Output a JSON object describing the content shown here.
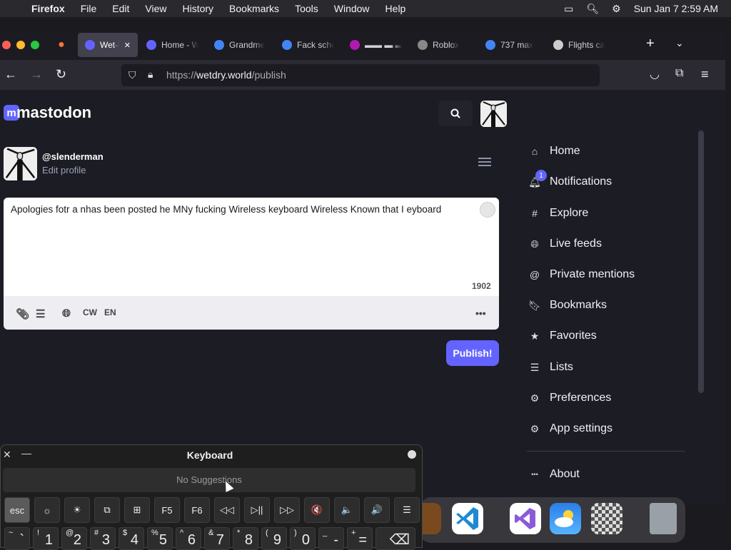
{
  "menubar": {
    "app": "Firefox",
    "items": [
      "File",
      "Edit",
      "View",
      "History",
      "Bookmarks",
      "Tools",
      "Window",
      "Help"
    ],
    "datetime": "Sun Jan 7  2:59 AM"
  },
  "tabs": [
    {
      "label": "Wet-Dr",
      "icon": "mastodon-icon",
      "color": "#6364ff",
      "active": true
    },
    {
      "label": "Home - W",
      "icon": "mastodon-icon",
      "color": "#6364ff"
    },
    {
      "label": "Grandme",
      "icon": "google-icon",
      "color": "#4285f4"
    },
    {
      "label": "Fack sche",
      "icon": "google-icon",
      "color": "#4285f4"
    },
    {
      "label": "▬▬ ▬ ▬",
      "icon": "purple-square-icon",
      "color": "#b01ab0"
    },
    {
      "label": "Roblox",
      "icon": "roblox-icon",
      "color": "#888888"
    },
    {
      "label": "737 max",
      "icon": "google-icon",
      "color": "#4285f4"
    },
    {
      "label": "Flights ca",
      "icon": "flights-icon",
      "color": "#cccccc"
    }
  ],
  "url": {
    "prefix": "https://",
    "domain": "wetdry.world",
    "path": "/publish"
  },
  "profile": {
    "handle": "@slenderman",
    "edit": "Edit profile"
  },
  "brand": "mastodon",
  "composer": {
    "text": "Apologies fotr a nhas been posted he MNy fucking  Wireless keyboard Wireless Known that I eyboard",
    "char_count": "1902",
    "cw": "CW",
    "lang": "EN"
  },
  "publish_label": "Publish!",
  "nav": [
    {
      "label": "Home",
      "icon": "home-icon"
    },
    {
      "label": "Notifications",
      "icon": "bell-icon",
      "badge": "1"
    },
    {
      "label": "Explore",
      "icon": "hashtag-icon"
    },
    {
      "label": "Live feeds",
      "icon": "globe-icon"
    },
    {
      "label": "Private mentions",
      "icon": "at-icon"
    },
    {
      "label": "Bookmarks",
      "icon": "bookmark-icon"
    },
    {
      "label": "Favorites",
      "icon": "star-icon"
    },
    {
      "label": "Lists",
      "icon": "list-icon"
    },
    {
      "label": "Preferences",
      "icon": "gear-icon"
    },
    {
      "label": "App settings",
      "icon": "cogs-icon"
    },
    {
      "label": "About",
      "icon": "ellipsis-icon"
    }
  ],
  "keyboard": {
    "title": "Keyboard",
    "suggestions": "No Suggestions",
    "fkeys": [
      "esc",
      "☼",
      "☀",
      "⧉",
      "⊞",
      "F5",
      "F6",
      "◁◁",
      "▷||",
      "▷▷",
      "🔇",
      "🔈",
      "🔊",
      "☰"
    ],
    "number_keys": [
      {
        "top": "~",
        "bot": "`"
      },
      {
        "top": "!",
        "bot": "1"
      },
      {
        "top": "@",
        "bot": "2"
      },
      {
        "top": "#",
        "bot": "3"
      },
      {
        "top": "$",
        "bot": "4"
      },
      {
        "top": "%",
        "bot": "5"
      },
      {
        "top": "^",
        "bot": "6"
      },
      {
        "top": "&",
        "bot": "7"
      },
      {
        "top": "*",
        "bot": "8"
      },
      {
        "top": "(",
        "bot": "9"
      },
      {
        "top": ")",
        "bot": "0"
      },
      {
        "top": "_",
        "bot": "-"
      },
      {
        "top": "+",
        "bot": "="
      },
      {
        "top": "",
        "bot": "⌫"
      }
    ]
  },
  "colors": {
    "accent": "#6364ff",
    "page_bg": "#1c1d24"
  }
}
